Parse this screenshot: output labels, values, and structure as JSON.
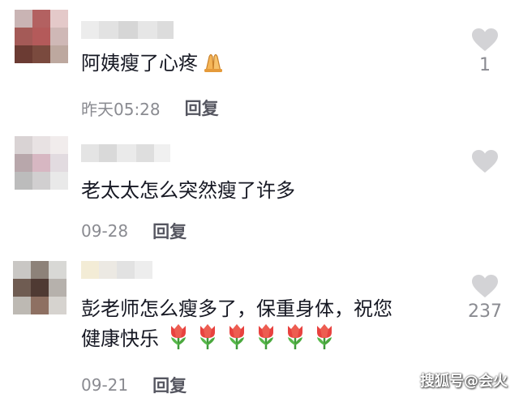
{
  "comments": [
    {
      "text": "阿姨瘦了心疼",
      "emoji": "folded-hands",
      "time": "昨天05:28",
      "reply_label": "回复",
      "like_count": "1"
    },
    {
      "text": "老太太怎么突然瘦了许多",
      "time": "09-28",
      "reply_label": "回复",
      "like_count": ""
    },
    {
      "text_line1": "彭老师怎么瘦多了，保重身体，祝您",
      "text_line2": "健康快乐",
      "emoji": "tulip",
      "emoji_count": 6,
      "time": "09-21",
      "reply_label": "回复",
      "like_count": "237"
    }
  ],
  "watermark": "搜狐号@会火",
  "colors": {
    "text": "#161823",
    "meta": "#8a8b91",
    "heart": "#d3d3d6"
  },
  "icons": [
    "heart-icon",
    "folded-hands-emoji",
    "tulip-emoji"
  ]
}
